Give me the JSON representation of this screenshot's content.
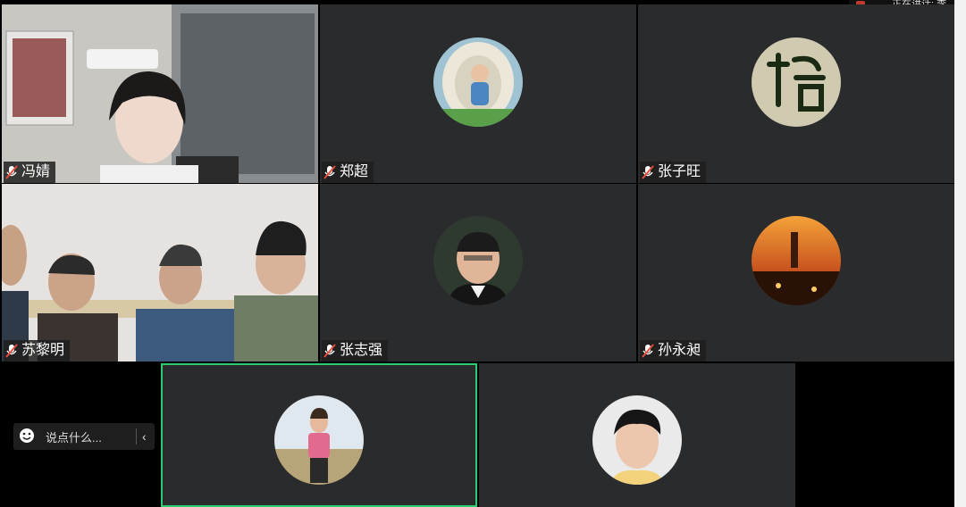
{
  "status_bar": {
    "speaking_text": "正在讲话: 李"
  },
  "participants": [
    {
      "name": "冯婧"
    },
    {
      "name": "郑超"
    },
    {
      "name": "张子旺"
    },
    {
      "name": "苏黎明"
    },
    {
      "name": "张志强"
    },
    {
      "name": "孙永昶"
    },
    {
      "name": ""
    },
    {
      "name": ""
    }
  ],
  "chat": {
    "placeholder": "说点什么...",
    "emoji_icon": "smile-icon",
    "collapse_icon": "chevron-left-icon"
  },
  "colors": {
    "active_border": "#2ecc71",
    "tile_bg": "#2a2b2d"
  }
}
